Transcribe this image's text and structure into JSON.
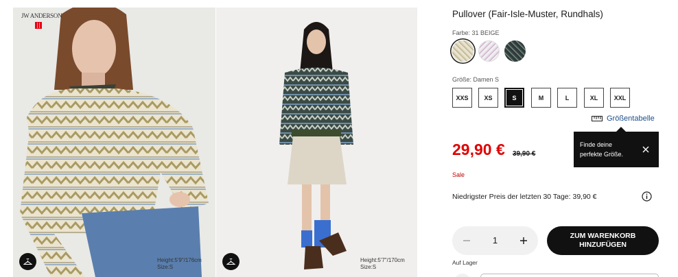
{
  "product": {
    "title": "Pullover (Fair-Isle-Muster, Rundhals)",
    "color_label": "Farbe: 31 BEIGE",
    "size_label": "Größe: Damen S",
    "sizes": [
      "XXS",
      "XS",
      "S",
      "M",
      "L",
      "XL",
      "XXL"
    ],
    "selected_size": "S",
    "size_chart_label": "Größentabelle",
    "tooltip_text": "Finde deine perfekte Größe.",
    "price": "29,90 €",
    "old_price": "39,90 €",
    "sale_label": "Sale",
    "lowest_price_text": "Niedrigster Preis der letzten 30 Tage: 39,90 €",
    "quantity": "1",
    "cart_button_label": "ZUM WARENKORB HINZUFÜGEN",
    "stock_label": "Auf Lager"
  },
  "swatches": [
    {
      "name": "beige",
      "color": "#e3dcc4",
      "selected": true
    },
    {
      "name": "pink",
      "color": "#ead9e6",
      "selected": false
    },
    {
      "name": "dark-green",
      "color": "#33423f",
      "selected": false
    }
  ],
  "photos": [
    {
      "brand": "JW ANDERSON",
      "model_height": "Height:5'9\"/176cm",
      "model_size": "Size:S"
    },
    {
      "model_height": "Height:5'7\"/170cm",
      "model_size": "Size:S"
    }
  ],
  "colors": {
    "price_red": "#e00000",
    "button_black": "#111111",
    "link_blue": "#1b4d8a"
  }
}
